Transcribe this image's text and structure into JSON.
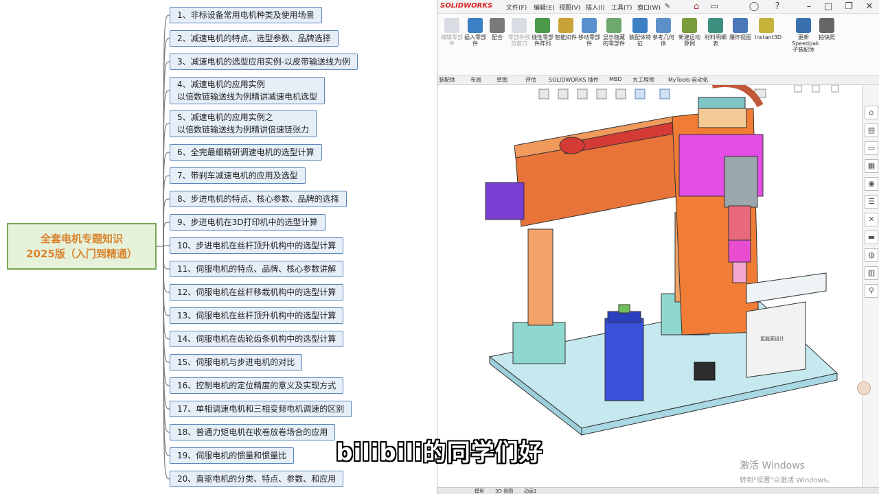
{
  "mindmap": {
    "root": {
      "line1": "全套电机专题知识",
      "line2": "2025版（入门到精通）"
    },
    "topics": [
      {
        "lines": [
          "1、非标设备常用电机种类及使用场景"
        ]
      },
      {
        "lines": [
          "2、减速电机的特点、选型参数、品牌选择"
        ]
      },
      {
        "lines": [
          "3、减速电机的选型应用实例-以皮带输送线为例"
        ]
      },
      {
        "lines": [
          "4、减速电机的应用实例",
          "以倍数链输送线为例精讲减速电机选型"
        ]
      },
      {
        "lines": [
          "5、减速电机的应用实例之",
          "以倍数链输送线为例精讲倍速链张力"
        ]
      },
      {
        "lines": [
          "6、全完最细精研调速电机的选型计算"
        ]
      },
      {
        "lines": [
          "7、带刹车减速电机的应用及选型"
        ]
      },
      {
        "lines": [
          "8、步进电机的特点、核心参数、品牌的选择"
        ]
      },
      {
        "lines": [
          "9、步进电机在3D打印机中的选型计算"
        ]
      },
      {
        "lines": [
          "10、步进电机在丝杆顶升机构中的选型计算"
        ]
      },
      {
        "lines": [
          "11、伺服电机的特点、品牌、核心参数讲解"
        ]
      },
      {
        "lines": [
          "12、伺服电机在丝杆移栽机构中的选型计算"
        ]
      },
      {
        "lines": [
          "13、伺服电机在丝杆顶升机构中的选型计算"
        ]
      },
      {
        "lines": [
          "14、伺服电机在齿轮齿条机构中的选型计算"
        ]
      },
      {
        "lines": [
          "15、伺服电机与步进电机的对比"
        ]
      },
      {
        "lines": [
          "16、控制电机的定位精度的意义及实现方式"
        ]
      },
      {
        "lines": [
          "17、单相调速电机和三相变频电机调速的区别"
        ]
      },
      {
        "lines": [
          "18、普通力矩电机在收卷放卷场合的应用"
        ]
      },
      {
        "lines": [
          "19、伺服电机的惯量和惯量比"
        ]
      },
      {
        "lines": [
          "20、直驱电机的分类、特点、参数、和应用"
        ]
      }
    ]
  },
  "solidworks": {
    "logo": "SOLIDWORKS",
    "menus": [
      "文件(F)",
      "编辑(E)",
      "视图(V)",
      "插入(I)",
      "工具(T)",
      "窗口(W)"
    ],
    "ribbon_buttons": [
      {
        "label": "编辑零部件",
        "icon": "edit-component-icon",
        "color": "#9aa7b8",
        "dim": true
      },
      {
        "label": "插入零部件",
        "icon": "insert-component-icon",
        "color": "#3b7fc4",
        "dim": false
      },
      {
        "label": "配合",
        "icon": "mate-icon",
        "color": "#7a7a7a",
        "dim": false
      },
      {
        "label": "零部件预览窗口",
        "icon": "component-preview-icon",
        "color": "#9aa7b8",
        "dim": true
      },
      {
        "label": "线性零部件阵列",
        "icon": "linear-pattern-icon",
        "color": "#4a9a4a",
        "dim": false
      },
      {
        "label": "智能扣件",
        "icon": "smart-fastener-icon",
        "color": "#c9a23a",
        "dim": false
      },
      {
        "label": "移动零部件",
        "icon": "move-component-icon",
        "color": "#5a8fd0",
        "dim": false
      },
      {
        "label": "显示隐藏的零部件",
        "icon": "show-hidden-icon",
        "color": "#6fa86f",
        "dim": false
      },
      {
        "label": "装配体特征",
        "icon": "assembly-feature-icon",
        "color": "#3b7fc4",
        "dim": false
      },
      {
        "label": "参考几何体",
        "icon": "reference-geometry-icon",
        "color": "#5d8fc9",
        "dim": false
      },
      {
        "label": "新建运动算例",
        "icon": "motion-study-icon",
        "color": "#7b9c3b",
        "dim": false
      },
      {
        "label": "材料明细表",
        "icon": "bom-icon",
        "color": "#3f8f7f",
        "dim": false
      },
      {
        "label": "爆炸视图",
        "icon": "exploded-view-icon",
        "color": "#4a77b8",
        "dim": false
      },
      {
        "label": "Instant3D",
        "icon": "instant3d-icon",
        "color": "#c6b33a",
        "dim": false
      },
      {
        "label": "更新Speedpak子装配体",
        "icon": "speedpak-icon",
        "color": "#3a6fb0",
        "dim": false
      },
      {
        "label": "拍快照",
        "icon": "snapshot-icon",
        "color": "#666666",
        "dim": false
      }
    ],
    "command_tabs": [
      "装配体",
      "布局",
      "草图",
      "评估",
      "SOLIDWORKS 插件",
      "MBD",
      "大工程师",
      "MyTools-自动化"
    ],
    "bottom_tabs": [
      "模型",
      "3D 视图",
      "动画1"
    ],
    "taskpane_icons": [
      "home-icon",
      "parts-icon",
      "folder-icon",
      "view-palette-icon",
      "appearance-icon",
      "custom-properties-icon",
      "tools-icon",
      "library-icon",
      "forum-icon",
      "table-icon",
      "help-icon"
    ]
  },
  "overlay": {
    "subtitle": "bilibili的同学们好",
    "watermark_line1": "激活 Windows",
    "watermark_line2": "转到\"设置\"以激活 Windows。"
  }
}
